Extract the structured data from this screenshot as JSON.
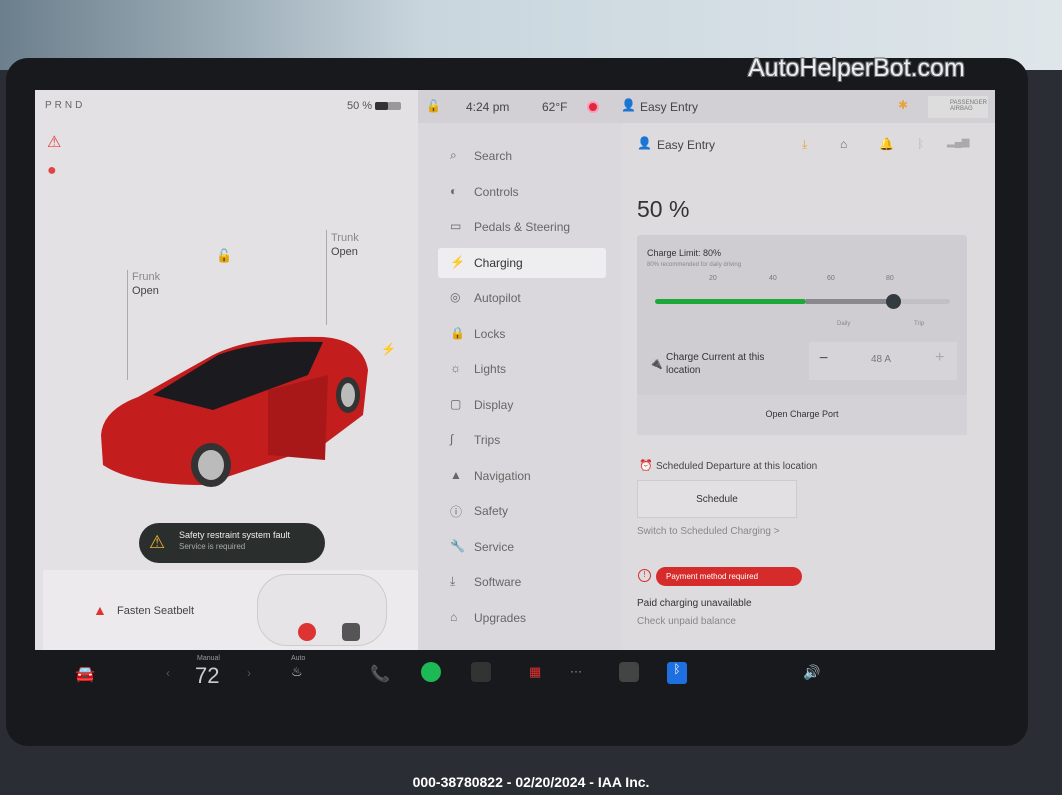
{
  "watermark": "AutoHelperBot.com",
  "caption": "000-38780822 - 02/20/2024 - IAA Inc.",
  "left_panel": {
    "gear": "PRND",
    "battery": "50 %",
    "battery_level": 0.5,
    "frunk_label": "Frunk",
    "frunk_state": "Open",
    "trunk_label": "Trunk",
    "trunk_state": "Open",
    "fault_title": "Safety restraint system fault",
    "fault_sub": "Service is required",
    "seatbelt": "Fasten Seatbelt"
  },
  "status_bar": {
    "time": "4:24 pm",
    "temp": "62°F",
    "profile": "Easy Entry",
    "airbag": "PASSENGER AIRBAG"
  },
  "menu": [
    {
      "label": "Search",
      "icon": "search-icon"
    },
    {
      "label": "Controls",
      "icon": "toggle-icon"
    },
    {
      "label": "Pedals & Steering",
      "icon": "car-icon"
    },
    {
      "label": "Charging",
      "icon": "bolt-icon"
    },
    {
      "label": "Autopilot",
      "icon": "steering-wheel-icon"
    },
    {
      "label": "Locks",
      "icon": "lock-icon"
    },
    {
      "label": "Lights",
      "icon": "sun-icon"
    },
    {
      "label": "Display",
      "icon": "display-icon"
    },
    {
      "label": "Trips",
      "icon": "trips-icon"
    },
    {
      "label": "Navigation",
      "icon": "navigation-icon"
    },
    {
      "label": "Safety",
      "icon": "info-icon"
    },
    {
      "label": "Service",
      "icon": "wrench-icon"
    },
    {
      "label": "Software",
      "icon": "download-icon"
    },
    {
      "label": "Upgrades",
      "icon": "bag-icon"
    }
  ],
  "active_menu": "Charging",
  "charging": {
    "profile": "Easy Entry",
    "percent": "50 %",
    "charge_limit": "Charge Limit: 80%",
    "recommend": "80% recommended for daily driving",
    "ticks": [
      "20",
      "40",
      "60",
      "80"
    ],
    "current_level": 50,
    "limit_level": 80,
    "daily": "Daily",
    "trip": "Trip",
    "current_label": "Charge Current at this location",
    "amps": "48 A",
    "minus": "−",
    "plus": "+",
    "open_port": "Open Charge Port",
    "sched_dep": "Scheduled Departure at this location",
    "schedule": "Schedule",
    "switch": "Switch to Scheduled Charging >",
    "payment": "Payment method required",
    "paid_unavail": "Paid charging unavailable",
    "check_balance": "Check unpaid balance"
  },
  "dock": {
    "climate_mode": "Manual",
    "temp": "72",
    "seat_mode": "Auto"
  },
  "colors": {
    "accent_green": "#1fa83a",
    "error_red": "#d62b2b",
    "bluetooth": "#1e6fe0"
  }
}
